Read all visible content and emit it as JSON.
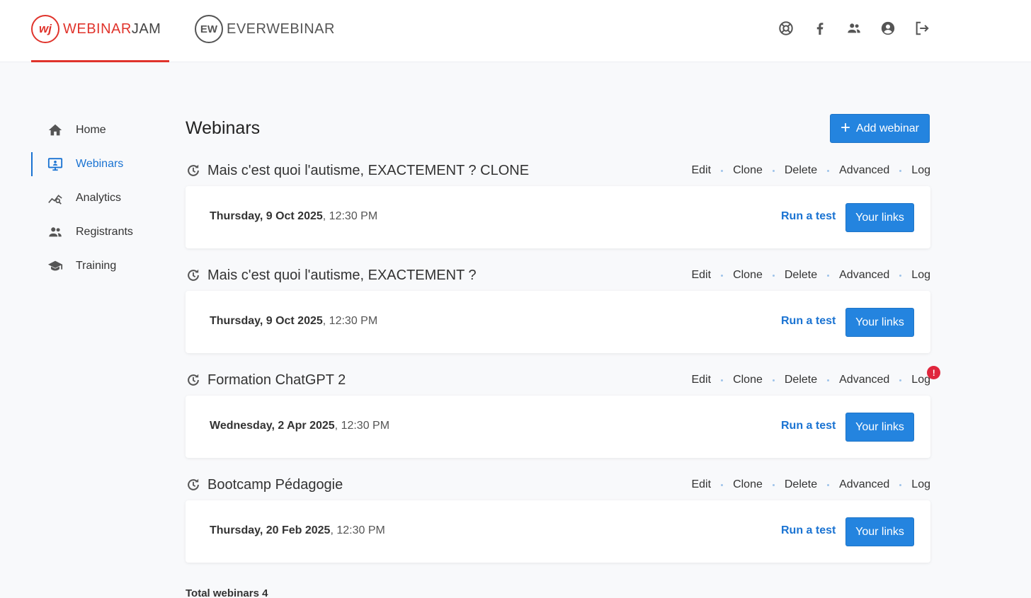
{
  "header": {
    "brand_webinarjam_a": "WEBINAR",
    "brand_webinarjam_b": "JAM",
    "brand_webinarjam_mark": "wj",
    "brand_everwebinar": "EVERWEBINAR",
    "brand_everwebinar_mark": "EW",
    "icons": [
      "support-icon",
      "facebook-icon",
      "community-icon",
      "account-icon",
      "logout-icon"
    ]
  },
  "sidebar": {
    "items": [
      {
        "label": "Home",
        "icon": "home-icon"
      },
      {
        "label": "Webinars",
        "icon": "webinar-monitor-icon"
      },
      {
        "label": "Analytics",
        "icon": "analytics-icon"
      },
      {
        "label": "Registrants",
        "icon": "registrants-icon"
      },
      {
        "label": "Training",
        "icon": "graduation-cap-icon"
      }
    ]
  },
  "main": {
    "title": "Webinars",
    "add_button": "Add webinar",
    "actions": {
      "edit": "Edit",
      "clone": "Clone",
      "delete": "Delete",
      "advanced": "Advanced",
      "log": "Log"
    },
    "run_test": "Run a test",
    "your_links": "Your links",
    "webinars": [
      {
        "title": "Mais c'est quoi l'autisme, EXACTEMENT ? CLONE",
        "date": "Thursday, 9 Oct 2025",
        "time": ", 12:30 PM",
        "log_alert": false
      },
      {
        "title": "Mais c'est quoi l'autisme, EXACTEMENT ?",
        "date": "Thursday, 9 Oct 2025",
        "time": ", 12:30 PM",
        "log_alert": false
      },
      {
        "title": "Formation ChatGPT 2",
        "date": "Wednesday, 2 Apr 2025",
        "time": ", 12:30 PM",
        "log_alert": true,
        "alert_symbol": "!"
      },
      {
        "title": "Bootcamp Pédagogie",
        "date": "Thursday, 20 Feb 2025",
        "time": ", 12:30 PM",
        "log_alert": false
      }
    ],
    "total": "Total webinars 4"
  },
  "colors": {
    "accent": "#2484df",
    "brand_red": "#e0342c",
    "alert": "#e0263d"
  }
}
